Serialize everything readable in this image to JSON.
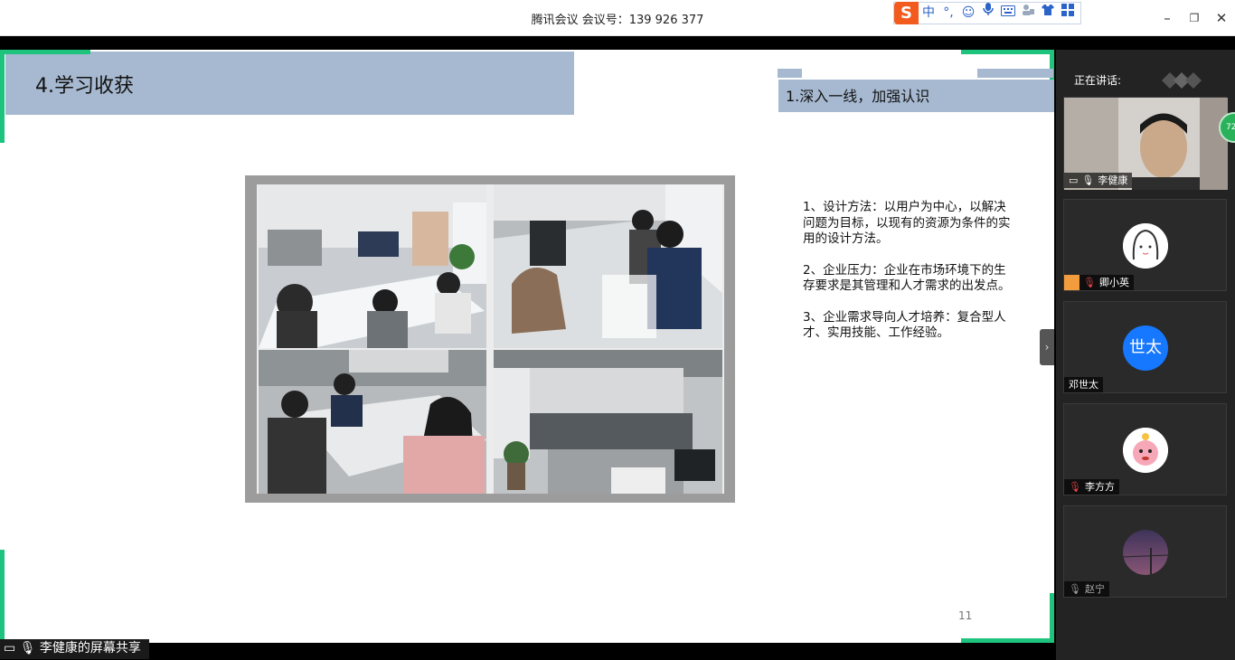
{
  "window": {
    "title": "腾讯会议 会议号：139 926 377",
    "ime_logo": "S",
    "ime_items": [
      "中",
      "°,",
      "☺",
      "🎤",
      "⌨",
      "👕",
      "▦"
    ],
    "minimize": "–",
    "restore": "❐",
    "close": "✕"
  },
  "slide": {
    "title": "4.学习收获",
    "subtitle": "1.深入一线，加强认识",
    "points": [
      "1、设计方法：以用户为中心，以解决问题为目标，以现有的资源为条件的实用的设计方法。",
      "2、企业压力：企业在市场环境下的生存要求是其管理和人才需求的出发点。",
      "3、企业需求导向人才培养：复合型人才、实用技能、工作经验。"
    ],
    "page_number": "11",
    "accent_color": "#1ec47d",
    "header_color": "#a7b9d1"
  },
  "share": {
    "label": "李健康的屏幕共享"
  },
  "panel": {
    "speaking_label": "正在讲话:",
    "collapse_glyph": "›",
    "badge_text": "72",
    "participants": [
      {
        "name": "李健康",
        "avatar_text": "",
        "muted": false
      },
      {
        "name": "卿小英",
        "avatar_text": "",
        "muted": true
      },
      {
        "name": "邓世太",
        "avatar_text": "世太",
        "muted": false
      },
      {
        "name": "李方方",
        "avatar_text": "",
        "muted": true
      },
      {
        "name": "赵宁",
        "avatar_text": "",
        "muted": true
      }
    ]
  }
}
